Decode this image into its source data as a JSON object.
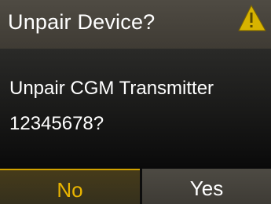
{
  "dialog": {
    "title": "Unpair Device?",
    "message_line1": "Unpair CGM Transmitter",
    "message_line2": "12345678?",
    "warning_icon": "warning-triangle-icon"
  },
  "buttons": {
    "no_label": "No",
    "yes_label": "Yes"
  },
  "colors": {
    "accent": "#e9b400",
    "selected_border": "#d1a200",
    "header_bg": "#4f4b43",
    "background": "#000000"
  }
}
